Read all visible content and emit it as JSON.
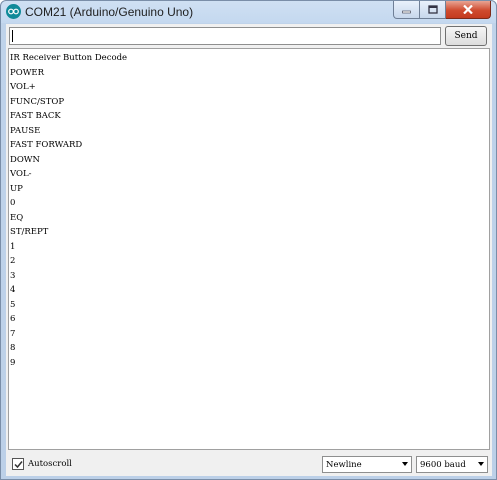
{
  "window": {
    "title": "COM21 (Arduino/Genuino Uno)",
    "icon": "arduino-icon"
  },
  "send": {
    "input_value": "",
    "button_label": "Send"
  },
  "output": {
    "lines": [
      "IR Receiver Button Decode",
      "POWER",
      "VOL+",
      "FUNC/STOP",
      "FAST BACK",
      "PAUSE",
      "FAST FORWARD",
      "DOWN",
      "VOL-",
      "UP",
      "0",
      "EQ",
      "ST/REPT",
      "1",
      "2",
      "3",
      "4",
      "5",
      "6",
      "7",
      "8",
      "9"
    ]
  },
  "footer": {
    "autoscroll_label": "Autoscroll",
    "autoscroll_checked": true,
    "line_ending": "Newline",
    "baud_rate": "9600 baud"
  }
}
